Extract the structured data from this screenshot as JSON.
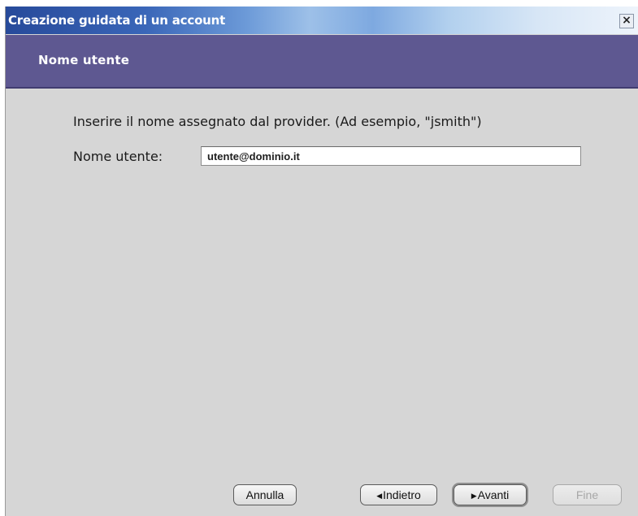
{
  "window": {
    "title": "Creazione guidata di un account",
    "close_glyph": "×"
  },
  "header": {
    "subtitle": "Nome utente"
  },
  "form": {
    "instruction": "Inserire il nome assegnato dal provider. (Ad esempio, \"jsmith\")",
    "username_label": "Nome utente:",
    "username_value": "utente@dominio.it"
  },
  "buttons": {
    "cancel": "Annulla",
    "back": "Indietro",
    "next": "Avanti",
    "finish": "Fine",
    "finish_enabled": false,
    "default": "next"
  },
  "icons": {
    "back_arrow": "left-triangle-icon",
    "next_arrow": "right-triangle-icon"
  },
  "colors": {
    "header_band": "#5e5891",
    "titlebar_start": "#274a9a",
    "titlebar_end": "#eef4fb"
  }
}
